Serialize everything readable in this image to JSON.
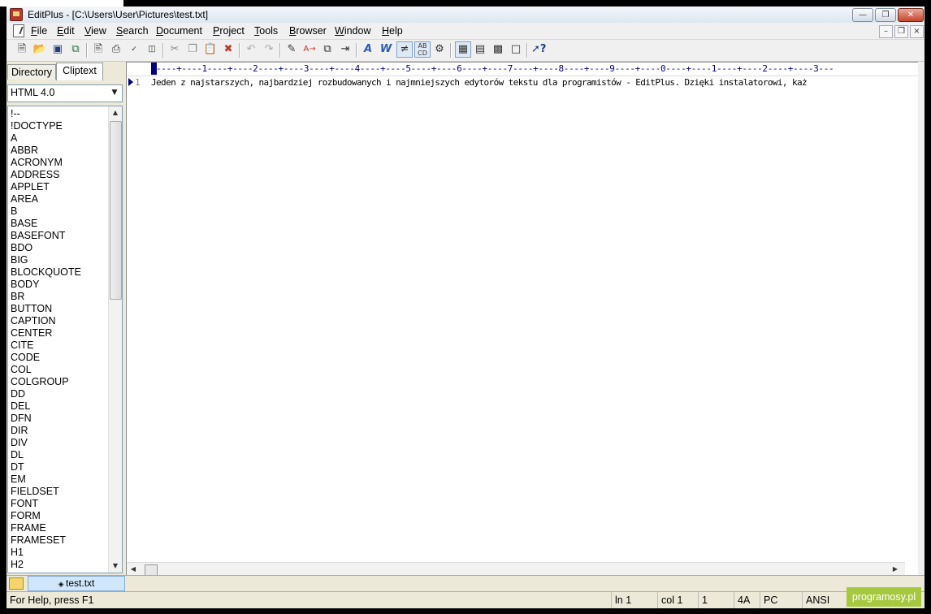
{
  "window": {
    "title": "EditPlus - [C:\\Users\\User\\Pictures\\test.txt]"
  },
  "menubar": {
    "items": [
      "File",
      "Edit",
      "View",
      "Search",
      "Document",
      "Project",
      "Tools",
      "Browser",
      "Window",
      "Help"
    ]
  },
  "toolbar": {
    "icons": [
      "new-file-icon",
      "open-icon",
      "save-icon",
      "save-all-icon",
      "print-preview-icon",
      "print-icon",
      "spell-check-icon",
      "html-preview-icon",
      "cut-icon",
      "copy-icon",
      "paste-icon",
      "delete-icon",
      "undo-icon",
      "redo-icon",
      "find-icon",
      "replace-icon",
      "copy-format-icon",
      "indent-icon",
      "font-icon",
      "bold-italic-icon",
      "word-wrap-icon",
      "ruler-icon",
      "options-icon",
      "view-directory-icon",
      "view-cliptext-icon",
      "output-icon",
      "function-list-icon",
      "help-context-icon"
    ]
  },
  "sidebar": {
    "tabs": [
      "Directory",
      "Cliptext"
    ],
    "active_tab": "Cliptext",
    "combo_value": "HTML 4.0",
    "tags": [
      "!--",
      "!DOCTYPE",
      "A",
      "ABBR",
      "ACRONYM",
      "ADDRESS",
      "APPLET",
      "AREA",
      "B",
      "BASE",
      "BASEFONT",
      "BDO",
      "BIG",
      "BLOCKQUOTE",
      "BODY",
      "BR",
      "BUTTON",
      "CAPTION",
      "CENTER",
      "CITE",
      "CODE",
      "COL",
      "COLGROUP",
      "DD",
      "DEL",
      "DFN",
      "DIR",
      "DIV",
      "DL",
      "DT",
      "EM",
      "FIELDSET",
      "FONT",
      "FORM",
      "FRAME",
      "FRAMESET",
      "H1",
      "H2"
    ]
  },
  "editor": {
    "ruler": "----+----1----+----2----+----3----+----4----+----5----+----6----+----7----+----8----+----9----+----0----+----1----+----2----+----3---",
    "line_number": "1",
    "line_text": "Jeden z najstarszych, najbardziej rozbudowanych i najmniejszych edytorów tekstu dla programistów - EditPlus. Dzięki instalatorowi, każ"
  },
  "document_tab": {
    "label": "test.txt"
  },
  "status": {
    "help": "For Help, press F1",
    "line": "ln 1",
    "col": "col 1",
    "sel": "1",
    "code": "4A",
    "mode": "PC",
    "encoding": "ANSI"
  },
  "watermark": "programosy.pl"
}
